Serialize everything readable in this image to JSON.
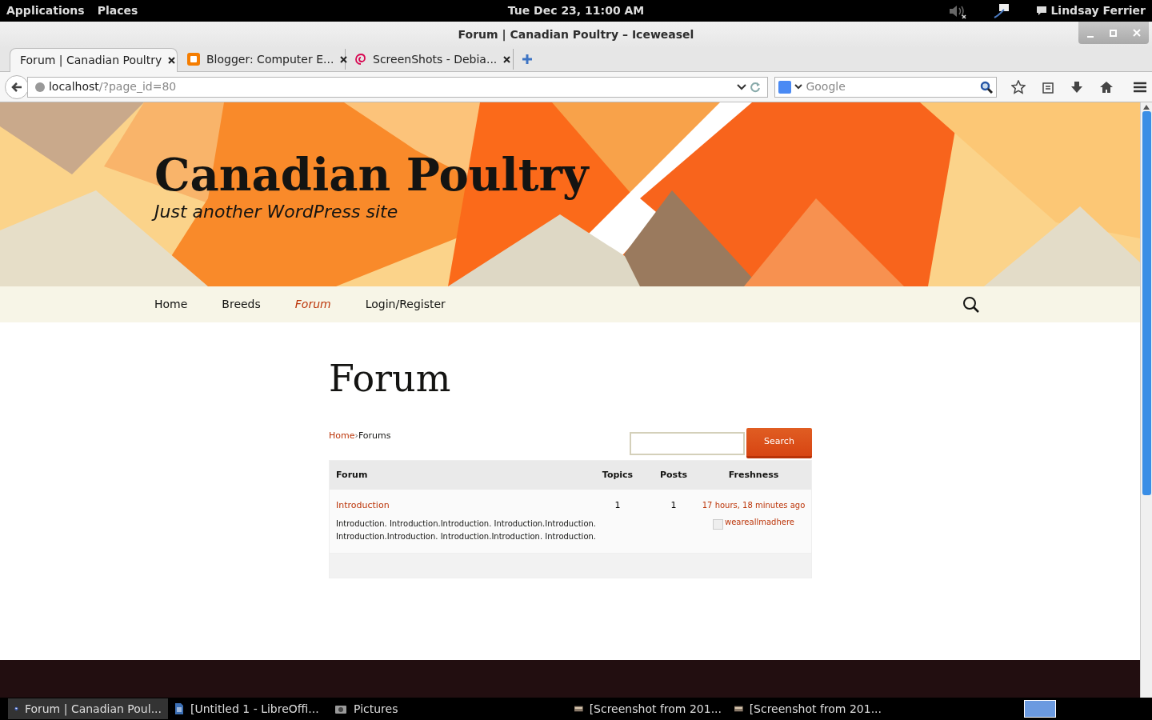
{
  "top_panel": {
    "menus": [
      "Applications",
      "Places"
    ],
    "clock": "Tue Dec 23, 11:00 AM",
    "user": "Lindsay Ferrier"
  },
  "window": {
    "title": "Forum | Canadian Poultry – Iceweasel"
  },
  "tabs": [
    {
      "label": "Forum | Canadian Poultry",
      "selected": true,
      "kind": "page"
    },
    {
      "label": "Blogger: Computer E...",
      "selected": false,
      "kind": "blogger"
    },
    {
      "label": "ScreenShots - Debia...",
      "selected": false,
      "kind": "debian"
    }
  ],
  "address_bar": {
    "host": "localhost",
    "path": "/?page_id=80"
  },
  "search_bar": {
    "placeholder": "Google"
  },
  "site": {
    "title": "Canadian Poultry",
    "tagline": "Just another WordPress site",
    "nav": [
      {
        "label": "Home",
        "selected": false
      },
      {
        "label": "Breeds",
        "selected": false
      },
      {
        "label": "Forum",
        "selected": true
      },
      {
        "label": "Login/Register",
        "selected": false
      }
    ]
  },
  "page": {
    "heading": "Forum",
    "breadcrumb": [
      "Home",
      "Forums"
    ],
    "breadcrumb_separator": "›",
    "search_button": "Search",
    "table": {
      "columns": [
        "Forum",
        "Topics",
        "Posts",
        "Freshness"
      ],
      "rows": [
        {
          "forum": "Introduction",
          "description": "Introduction. Introduction.Introduction. Introduction.Introduction. Introduction.Introduction. Introduction.Introduction. Introduction.",
          "topics": "1",
          "posts": "1",
          "freshness": "17 hours, 18 minutes ago",
          "author": "weareallmadhere"
        }
      ]
    }
  },
  "taskbar": [
    {
      "label": "Forum | Canadian Poul...",
      "selected": true,
      "kind": "browser"
    },
    {
      "label": "[Untitled 1 - LibreOffi...",
      "selected": false,
      "kind": "document"
    },
    {
      "label": "Pictures",
      "selected": false,
      "kind": "folder"
    },
    {
      "label": "[Screenshot from 201...",
      "selected": false,
      "kind": "image"
    },
    {
      "label": "[Screenshot from 201...",
      "selected": false,
      "kind": "image"
    }
  ]
}
